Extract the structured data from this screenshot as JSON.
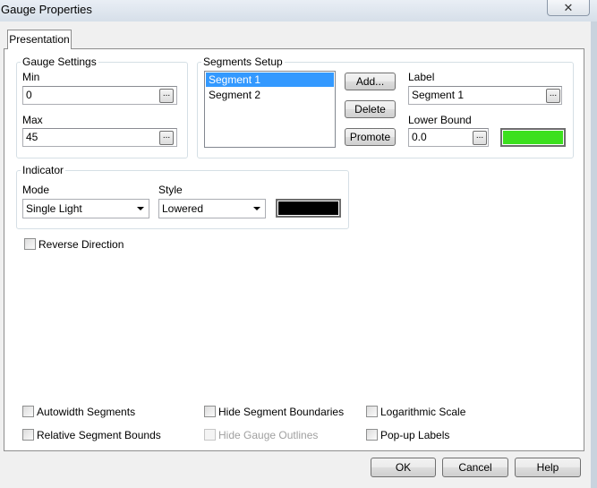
{
  "window": {
    "title": "Gauge Properties",
    "close_glyph": "✕"
  },
  "tabs": [
    {
      "label": "Presentation",
      "active": true
    }
  ],
  "gauge_settings": {
    "title": "Gauge Settings",
    "min_label": "Min",
    "min_value": "0",
    "max_label": "Max",
    "max_value": "45",
    "browse_glyph": "..."
  },
  "segments_setup": {
    "title": "Segments Setup",
    "segments": [
      {
        "label": "Segment 1",
        "selected": true
      },
      {
        "label": "Segment 2",
        "selected": false
      }
    ],
    "add_label": "Add...",
    "delete_label": "Delete",
    "promote_label": "Promote",
    "label_caption": "Label",
    "label_value": "Segment 1",
    "lower_bound_caption": "Lower Bound",
    "lower_bound_value": "0.0",
    "segment_color": "#3ce01e",
    "browse_glyph": "..."
  },
  "indicator": {
    "title": "Indicator",
    "mode_label": "Mode",
    "mode_value": "Single Light",
    "style_label": "Style",
    "style_value": "Lowered",
    "color": "#000000"
  },
  "options": {
    "reverse_direction": {
      "label": "Reverse Direction",
      "checked": false
    },
    "autowidth_segments": {
      "label": "Autowidth Segments",
      "checked": false
    },
    "relative_segment_bounds": {
      "label": "Relative Segment Bounds",
      "checked": false
    },
    "hide_segment_boundaries": {
      "label": "Hide Segment Boundaries",
      "checked": false
    },
    "hide_gauge_outlines": {
      "label": "Hide Gauge Outlines",
      "checked": false,
      "disabled": true
    },
    "logarithmic_scale": {
      "label": "Logarithmic Scale",
      "checked": false
    },
    "popup_labels": {
      "label": "Pop-up Labels",
      "checked": false
    }
  },
  "dialog_buttons": {
    "ok": "OK",
    "cancel": "Cancel",
    "help": "Help"
  }
}
